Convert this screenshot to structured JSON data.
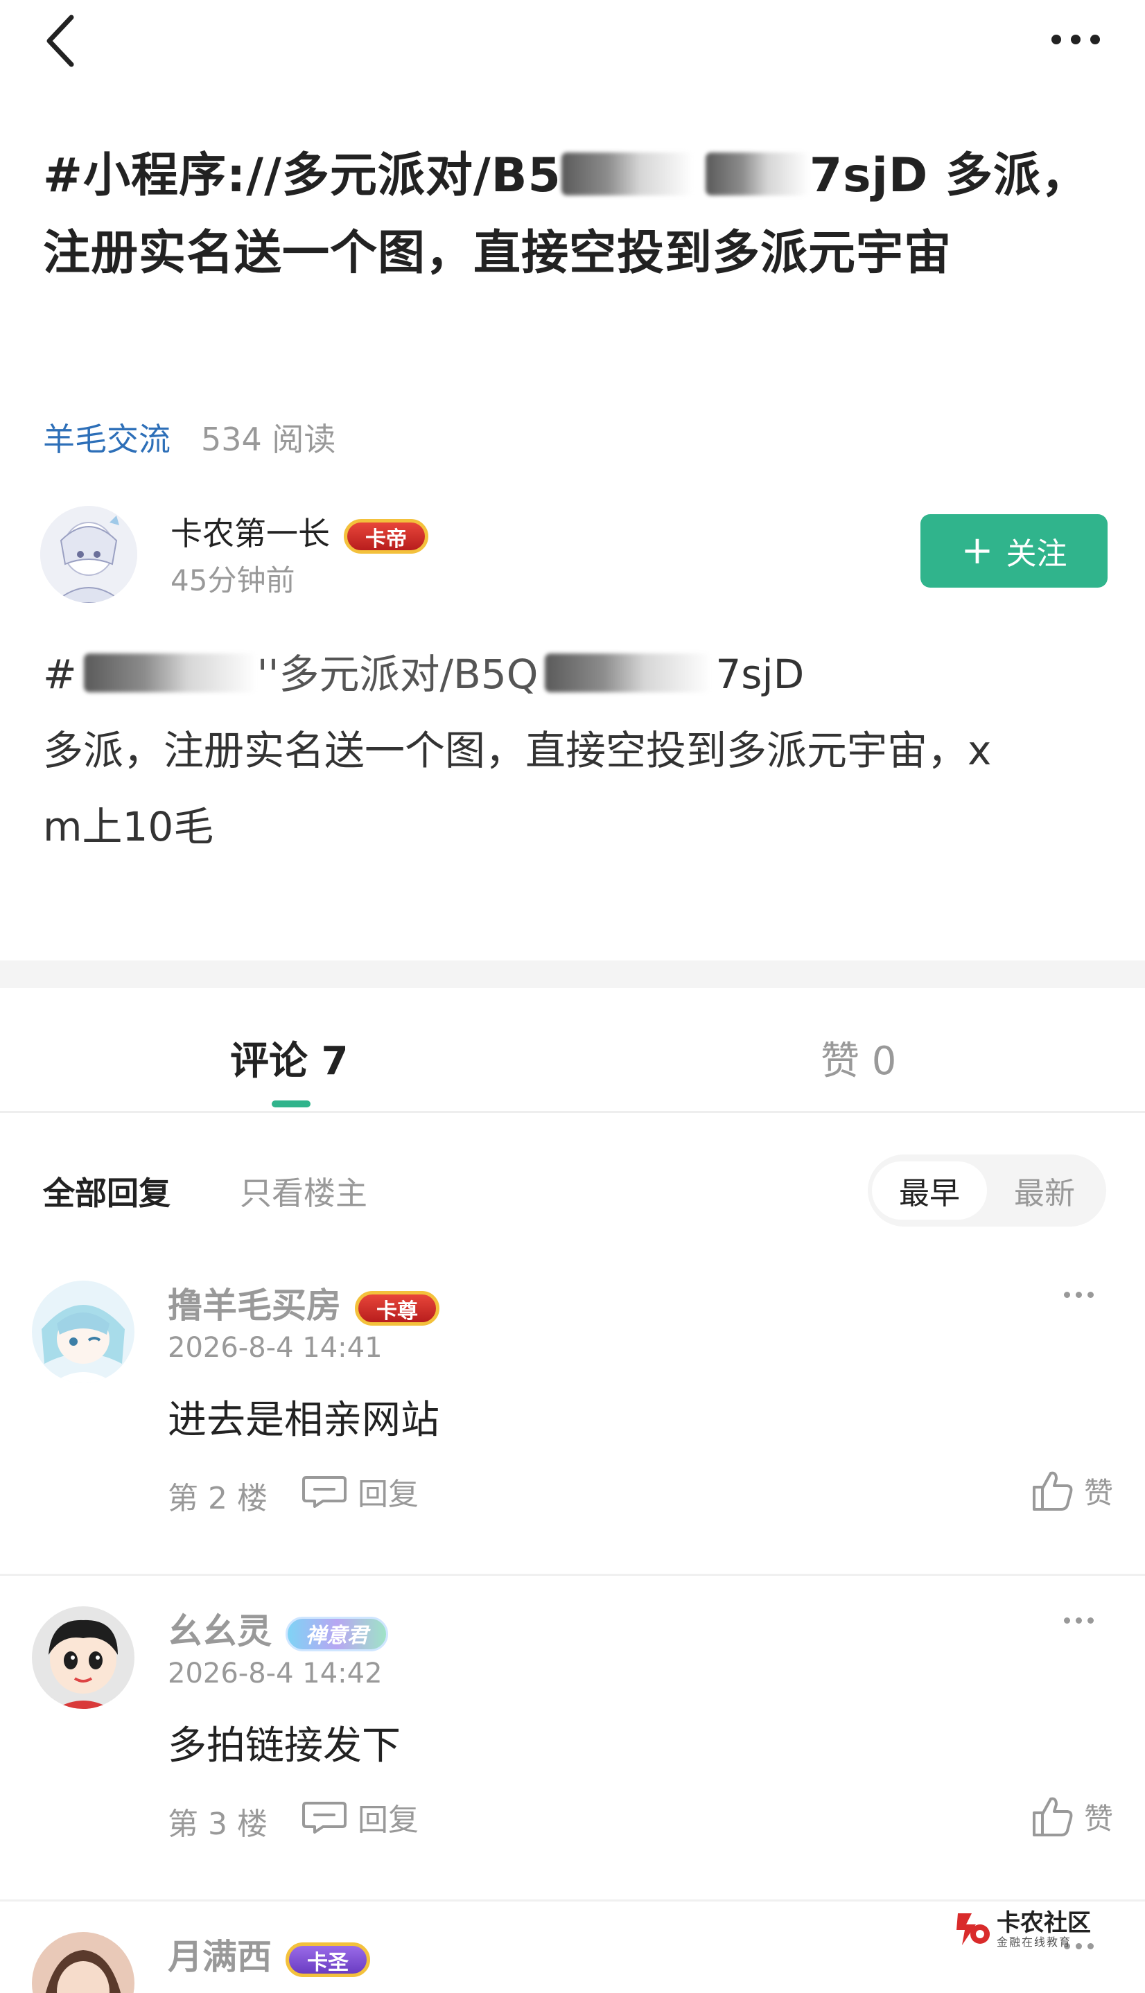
{
  "nav": {
    "back_icon": "chevron-left-icon",
    "more_icon": "more-horizontal-icon"
  },
  "post": {
    "title_part1": "#小程序://多元派对/B5",
    "title_part2": "7sjD 多派，注册实名送一个图，直接空投到多派元宇宙",
    "topic": "羊毛交流",
    "read_count": "534 阅读",
    "author": {
      "name": "卡农第一长",
      "badge": "卡帝",
      "time": "45分钟前"
    },
    "follow_label": "关注",
    "body_line1_a": "#",
    "body_line1_b": "''多元派对/B5Q",
    "body_line1_c": "7sjD",
    "body_line2": "多派，注册实名送一个图，直接空投到多派元宇宙，x",
    "body_line3": "m上10毛"
  },
  "tabs": {
    "comments": "评论 7",
    "likes": "赞 0"
  },
  "filters": {
    "all": "全部回复",
    "op_only": "只看楼主",
    "sort_earliest": "最早",
    "sort_latest": "最新"
  },
  "comments": [
    {
      "name": "撸羊毛买房",
      "badge": "卡尊",
      "time": "2026-8-4 14:41",
      "text": "进去是相亲网站",
      "floor": "第 2 楼",
      "reply_label": "回复",
      "like_label": "赞"
    },
    {
      "name": "幺幺灵",
      "badge": "禅意君",
      "time": "2026-8-4 14:42",
      "text": "多拍链接发下",
      "floor": "第 3 楼",
      "reply_label": "回复",
      "like_label": "赞"
    },
    {
      "name": "月满西",
      "badge": "卡圣"
    }
  ],
  "watermark": {
    "name": "卡农社区",
    "subtitle": "金融在线教育"
  },
  "colors": {
    "accent_green": "#30b48c",
    "link_blue": "#2d6fb8",
    "muted_gray": "#999999"
  }
}
